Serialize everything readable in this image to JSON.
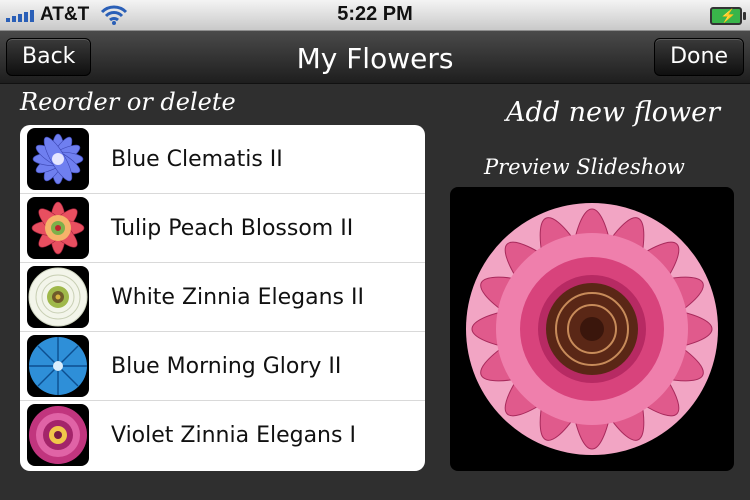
{
  "status_bar": {
    "carrier": "AT&T",
    "time": "5:22 PM",
    "signal_icon": "signal-bars-icon",
    "wifi_icon": "wifi-icon",
    "battery_icon": "battery-charging-icon"
  },
  "nav": {
    "back_label": "Back",
    "title": "My Flowers",
    "done_label": "Done"
  },
  "labels": {
    "reorder": "Reorder or delete",
    "add_new": "Add new flower",
    "preview": "Preview Slideshow"
  },
  "flowers": [
    {
      "name": "Blue Clematis II",
      "color": "#6f7ff0"
    },
    {
      "name": "Tulip Peach Blossom II",
      "color": "#e84f60"
    },
    {
      "name": "White Zinnia Elegans II",
      "color": "#e6ecd8"
    },
    {
      "name": "Blue Morning Glory II",
      "color": "#2e8fd8"
    },
    {
      "name": "Violet Zinnia Elegans I",
      "color": "#c1357e"
    }
  ],
  "colors": {
    "accent_pink": "#e05a8c",
    "status_blue": "#2a5fb7",
    "battery_green": "#39b54a"
  }
}
